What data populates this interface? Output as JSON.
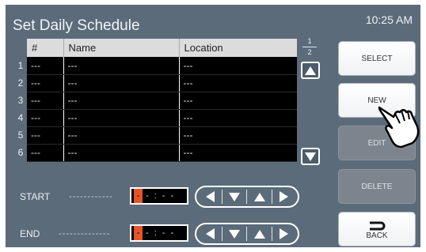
{
  "header": {
    "title": "Set Daily Schedule",
    "time": "10:25 AM"
  },
  "table": {
    "columns": [
      "#",
      "Name",
      "Location"
    ],
    "rows": [
      {
        "index": "1",
        "num": "---",
        "name": "---",
        "location": "---"
      },
      {
        "index": "2",
        "num": "---",
        "name": "---",
        "location": "---"
      },
      {
        "index": "3",
        "num": "---",
        "name": "---",
        "location": "---"
      },
      {
        "index": "4",
        "num": "---",
        "name": "---",
        "location": "---"
      },
      {
        "index": "5",
        "num": "---",
        "name": "---",
        "location": "---"
      },
      {
        "index": "6",
        "num": "---",
        "name": "---",
        "location": "---"
      }
    ]
  },
  "pager": {
    "current": "1",
    "total": "2"
  },
  "buttons": {
    "select": "SELECT",
    "new": "NEW",
    "edit": "EDIT",
    "delete": "DELETE",
    "back": "BACK"
  },
  "time_fields": {
    "start": {
      "label": "START",
      "dashes": "------------",
      "cursor": "-",
      "value": "- : - -"
    },
    "end": {
      "label": "END",
      "dashes": "--------------",
      "cursor": "-",
      "value": "- : - -"
    }
  },
  "colors": {
    "panel": "#5b6b7a",
    "cursor": "#e8542a",
    "disabled_button": "#7c858e"
  },
  "icons": [
    "arrow-up-icon",
    "arrow-down-icon",
    "arrow-left-icon",
    "arrow-right-icon",
    "back-icon",
    "pointing-hand-icon"
  ]
}
